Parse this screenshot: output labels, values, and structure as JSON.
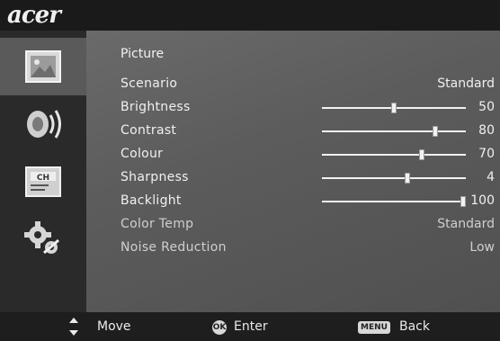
{
  "brand": "acer",
  "menu": {
    "title": "Picture",
    "items": [
      {
        "label": "Scenario",
        "value": "Standard",
        "type": "select"
      },
      {
        "label": "Brightness",
        "value": "50",
        "type": "slider",
        "level": 0.5
      },
      {
        "label": "Contrast",
        "value": "80",
        "type": "slider",
        "level": 0.8
      },
      {
        "label": "Colour",
        "value": "70",
        "type": "slider",
        "level": 0.7
      },
      {
        "label": "Sharpness",
        "value": "4",
        "type": "slider",
        "level": 0.6
      },
      {
        "label": "Backlight",
        "value": "100",
        "type": "slider",
        "level": 1.0
      },
      {
        "label": "Color Temp",
        "value": "Standard",
        "type": "select"
      },
      {
        "label": "Noise Reduction",
        "value": "Low",
        "type": "select"
      }
    ]
  },
  "rail": [
    {
      "icon": "picture-icon",
      "active": true
    },
    {
      "icon": "speaker-icon",
      "active": false
    },
    {
      "icon": "channel-icon",
      "active": false,
      "label": "CH"
    },
    {
      "icon": "settings-gears-icon",
      "active": false
    }
  ],
  "footer": {
    "move": "Move",
    "ok_key": "OK",
    "enter": "Enter",
    "menu_key": "MENU",
    "back": "Back"
  }
}
